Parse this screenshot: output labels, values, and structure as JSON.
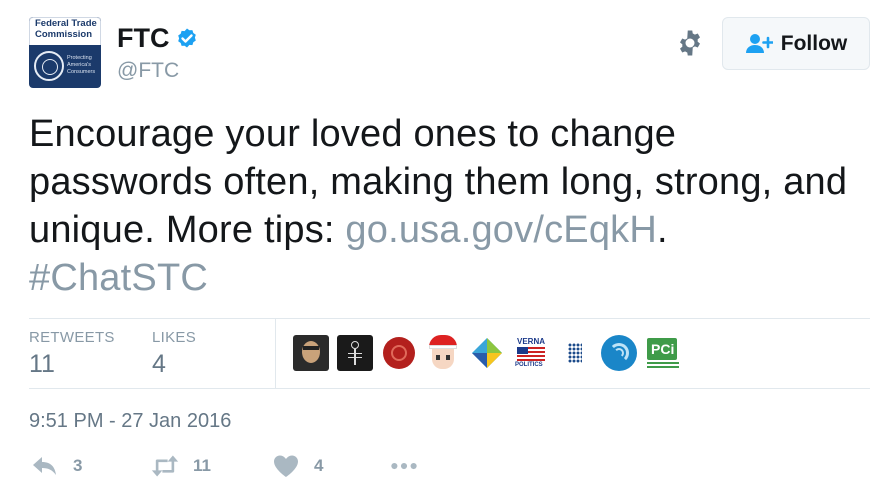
{
  "account": {
    "name": "FTC",
    "handle": "@FTC",
    "avatar_title": "Federal Trade Commission",
    "avatar_subtitle": "Protecting America's Consumers"
  },
  "follow_button": {
    "label": "Follow"
  },
  "tweet": {
    "text_before_link": "Encourage your loved ones to change passwords often, making them long, strong, and unique. More tips: ",
    "link": "go.usa.gov/cEqkH",
    "text_after_link": ".",
    "hashtag": "#ChatSTC"
  },
  "stats": {
    "retweets_label": "RETWEETS",
    "retweets_value": "11",
    "likes_label": "LIKES",
    "likes_value": "4"
  },
  "timestamp": "9:51 PM - 27 Jan 2016",
  "actions": {
    "reply_count": "3",
    "retweet_count": "11",
    "like_count": "4"
  },
  "likers": [
    "avatar-photo-person",
    "avatar-dark-skeleton",
    "avatar-red-seal",
    "avatar-anime-santa",
    "avatar-geometric-cube",
    "avatar-verna-politics",
    "avatar-dot-grid",
    "avatar-blue-wave",
    "avatar-pci-council"
  ],
  "colors": {
    "accent_gray": "#8899a6",
    "text": "#14171a",
    "verified_blue": "#1da1f2",
    "avatar_navy": "#1b3a6b"
  },
  "icons": {
    "settings": "gear-icon",
    "follow": "add-user-icon",
    "verified": "verified-badge-icon",
    "reply": "reply-icon",
    "retweet": "retweet-icon",
    "like": "heart-icon",
    "more": "more-dots-icon"
  }
}
